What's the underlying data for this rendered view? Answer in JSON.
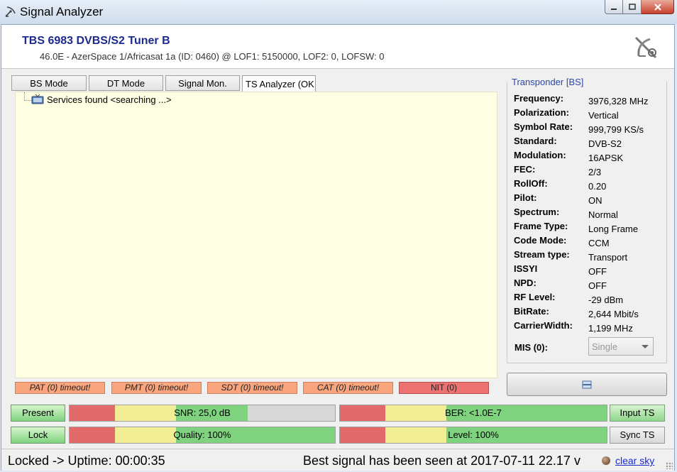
{
  "window": {
    "title": "Signal Analyzer",
    "icon": "satellite-dish-icon"
  },
  "header": {
    "device_name": "TBS 6983 DVBS/S2 Tuner B",
    "device_info": "46.0E - AzerSpace 1/Africasat 1a (ID: 0460) @ LOF1: 5150000, LOF2: 0, LOFSW: 0"
  },
  "tabs": [
    {
      "label": "BS Mode"
    },
    {
      "label": "DT Mode"
    },
    {
      "label": "Signal Mon."
    },
    {
      "label": "TS Analyzer (OK"
    }
  ],
  "tree": {
    "root_label": "Services found <searching ...>"
  },
  "timeouts": [
    {
      "label": "PAT (0) timeout!"
    },
    {
      "label": "PMT (0) timeout!"
    },
    {
      "label": "SDT (0) timeout!"
    },
    {
      "label": "CAT (0) timeout!"
    },
    {
      "label": "NIT (0)"
    }
  ],
  "transponder": {
    "title": "Transponder [BS]",
    "rows": [
      {
        "key": "Frequency:",
        "value": "3976,328 MHz"
      },
      {
        "key": "Polarization:",
        "value": "Vertical"
      },
      {
        "key": "Symbol Rate:",
        "value": "999,799 KS/s"
      },
      {
        "key": "Standard:",
        "value": "DVB-S2"
      },
      {
        "key": "Modulation:",
        "value": "16APSK"
      },
      {
        "key": "FEC:",
        "value": "2/3"
      },
      {
        "key": "RollOff:",
        "value": "0.20"
      },
      {
        "key": "Pilot:",
        "value": "ON"
      },
      {
        "key": "Spectrum:",
        "value": "Normal"
      },
      {
        "key": "Frame Type:",
        "value": "Long Frame"
      },
      {
        "key": "Code Mode:",
        "value": "CCM"
      },
      {
        "key": "Stream type:",
        "value": "Transport"
      },
      {
        "key": "ISSYI",
        "value": "OFF"
      },
      {
        "key": "NPD:",
        "value": "OFF"
      },
      {
        "key": "RF Level:",
        "value": "-29 dBm"
      },
      {
        "key": "BitRate:",
        "value": "2,644 Mbit/s"
      },
      {
        "key": "CarrierWidth:",
        "value": "1,199 MHz"
      }
    ],
    "mis_label": "MIS (0):",
    "mis_value": "Single"
  },
  "status": {
    "present_label": "Present",
    "lock_label": "Lock",
    "snr_label": "SNR: 25,0 dB",
    "snr_fill": 0.67,
    "ber_label": "BER: <1.0E-7",
    "ber_fill": 1.0,
    "quality_label": "Quality: 100%",
    "quality_fill": 1.0,
    "level_label": "Level: 100%",
    "level_fill": 1.0,
    "input_ts_label": "Input TS",
    "sync_ts_label": "Sync TS"
  },
  "statusbar": {
    "left_text": "Locked -> Uptime: 00:00:35",
    "right_text": "Best signal has been seen at 2017-07-11 22.17 v",
    "link_text": "clear sky"
  },
  "colors": {
    "accent_blue": "#1b2a8c",
    "meter_red": "#e36a6a",
    "meter_yellow": "#f2ee95",
    "meter_green": "#7fd37f",
    "tree_background": "#ffffe3"
  }
}
